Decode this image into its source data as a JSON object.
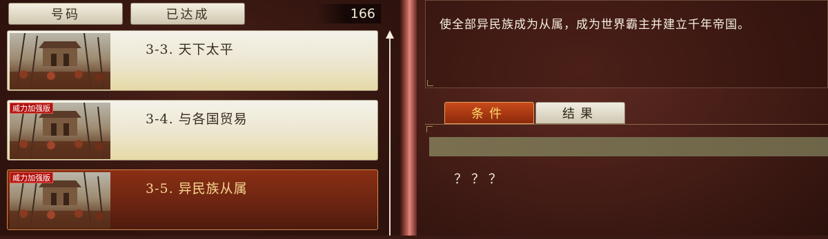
{
  "header": {
    "tab_number": "号码",
    "tab_achieved": "已达成",
    "count": "166"
  },
  "missions": [
    {
      "title": "3-3. 天下太平",
      "badge": ""
    },
    {
      "title": "3-4. 与各国贸易",
      "badge": "威力加强版"
    },
    {
      "title": "3-5. 异民族从属",
      "badge": "威力加强版"
    }
  ],
  "detail": {
    "description": "使全部异民族成为从属，成为世界霸主并建立千年帝国。",
    "tab_conditions": "条件",
    "tab_results": "结果",
    "condition_text": "？？？"
  },
  "colors": {
    "badge_red": "#b3120f",
    "selected_title": "#f6d890",
    "active_tab_text": "#ffd86a"
  }
}
